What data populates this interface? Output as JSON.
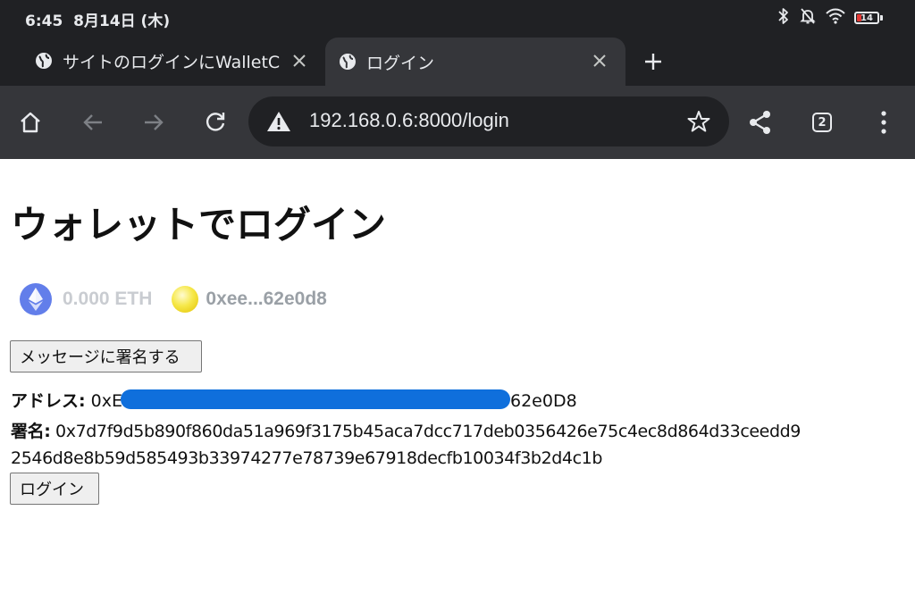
{
  "status_bar": {
    "time": "6:45",
    "date": "8月14日 (木)",
    "battery": "14",
    "battery_color": "#e53935"
  },
  "tabs": [
    {
      "title": "サイトのログインにWalletC",
      "active": false,
      "icon": "globe-icon"
    },
    {
      "title": "ログイン",
      "active": true,
      "icon": "globe-icon"
    }
  ],
  "toolbar": {
    "url": "192.168.0.6:8000/login",
    "tab_count": "2",
    "icons": [
      "home-icon",
      "back-icon",
      "forward-icon",
      "reload-icon",
      "warning-icon",
      "star-icon",
      "share-icon",
      "tab-switcher-icon",
      "more-icon"
    ]
  },
  "page": {
    "title": "ウォレットでログイン",
    "wallet": {
      "balance": "0.000 ETH",
      "address": "0xee...62e0d8",
      "eth_color": "#627eea"
    },
    "sign_button": "メッセージに署名する",
    "address_label": "アドレス:",
    "address_prefix": "0xE",
    "address_suffix": "62e0D8",
    "signature_label": "署名:",
    "signature_line1": "0x7d7f9d5b890f860da51a969f3175b45aca7dcc717deb0356426e75c4ec8d864d33ceedd9",
    "signature_line2": "2546d8e8b59d585493b33974277e78739e67918decfb10034f3b2d4c1b",
    "login_button": "ログイン",
    "redaction_color": "#0f6fdc"
  }
}
